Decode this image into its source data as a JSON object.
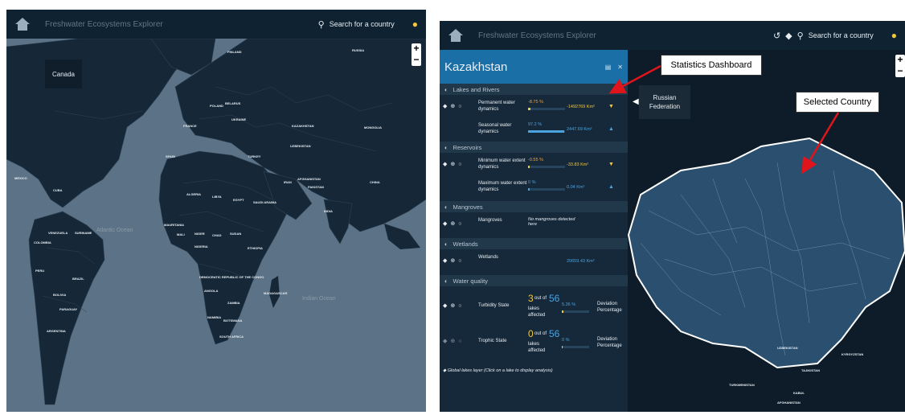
{
  "app": {
    "title": "Freshwater Ecosystems Explorer",
    "search_placeholder": "Search for a country"
  },
  "left_view": {
    "hover_country": "Canada",
    "country_labels": [
      {
        "name": "FINLAND"
      },
      {
        "name": "RUSSIA"
      },
      {
        "name": "POLAND"
      },
      {
        "name": "BELARUS"
      },
      {
        "name": "UKRAINE"
      },
      {
        "name": "KAZAKHSTAN"
      },
      {
        "name": "MONGOLIA"
      },
      {
        "name": "FRANCE"
      },
      {
        "name": "SPAIN"
      },
      {
        "name": "TURKEY"
      },
      {
        "name": "UZBEKISTAN"
      },
      {
        "name": "IRAN"
      },
      {
        "name": "CHINA"
      },
      {
        "name": "AFGHANISTAN"
      },
      {
        "name": "PAKISTAN"
      },
      {
        "name": "ALGERIA"
      },
      {
        "name": "LIBYA"
      },
      {
        "name": "EGYPT"
      },
      {
        "name": "SAUDI ARABIA"
      },
      {
        "name": "INDIA"
      },
      {
        "name": "MAURITANIA"
      },
      {
        "name": "MALI"
      },
      {
        "name": "NIGER"
      },
      {
        "name": "CHAD"
      },
      {
        "name": "SUDAN"
      },
      {
        "name": "NIGERIA"
      },
      {
        "name": "ETHIOPIA"
      },
      {
        "name": "DEMOCRATIC REPUBLIC OF THE CONGO"
      },
      {
        "name": "ANGOLA"
      },
      {
        "name": "ZAMBIA"
      },
      {
        "name": "NAMIBIA"
      },
      {
        "name": "BOTSWANA"
      },
      {
        "name": "SOUTH AFRICA"
      },
      {
        "name": "MADAGASCAR"
      },
      {
        "name": "VENEZUELA"
      },
      {
        "name": "COLOMBIA"
      },
      {
        "name": "PERU"
      },
      {
        "name": "BRAZIL"
      },
      {
        "name": "BOLIVIA"
      },
      {
        "name": "PARAGUAY"
      },
      {
        "name": "ARGENTINA"
      },
      {
        "name": "MEXICO"
      },
      {
        "name": "CUBA"
      },
      {
        "name": "SURINAME"
      }
    ],
    "oceans": [
      {
        "name": "Atlantic Ocean"
      },
      {
        "name": "Indian Ocean"
      }
    ]
  },
  "right_view": {
    "country": "Kazakhstan",
    "neighbor_tooltip": "Russian Federation",
    "map_labels": [
      {
        "name": "TURKMENISTAN"
      },
      {
        "name": "KYRGYZSTAN"
      },
      {
        "name": "UZBEKISTAN"
      },
      {
        "name": "TAJIKISTAN"
      },
      {
        "name": "AFGHANISTAN"
      },
      {
        "name": "KABUL"
      }
    ],
    "sections": [
      {
        "name": "Lakes and Rivers"
      },
      {
        "name": "Reservoirs"
      },
      {
        "name": "Mangroves"
      },
      {
        "name": "Wetlands"
      },
      {
        "name": "Water quality"
      }
    ],
    "rows": {
      "permanent": {
        "name": "Permanent water dynamics",
        "pct": "-8.75 %",
        "value": "-1492769 Km²",
        "fill": 0.06,
        "arrow": "▼"
      },
      "seasonal": {
        "name": "Seasonal water dynamics",
        "pct": "97.2 %",
        "value": "2447.69 Km²",
        "fill": 0.97,
        "arrow": "▲"
      },
      "min_extent": {
        "name": "Minimum water extent dynamics",
        "pct": "-0.55 %",
        "value": "-33.83 Km²",
        "fill": 0.04,
        "arrow": "▼"
      },
      "max_extent": {
        "name": "Maximum water extent dynamics",
        "pct": "0 %",
        "value": "0.04 Km²",
        "fill": 0.0,
        "arrow": "▲"
      },
      "mangroves": {
        "name": "Mangroves",
        "note": "No mangroves detected here"
      },
      "wetlands": {
        "name": "Wetlands",
        "value": "20659.43 Km²"
      },
      "turbidity": {
        "name": "Turbidity State",
        "count": "3",
        "out_of": "out of",
        "total": "56",
        "lakes": "lakes affected",
        "pct": "5.36 %",
        "fill": 0.05,
        "dev": "Deviation Percentage"
      },
      "trophic": {
        "name": "Trophic State",
        "count": "0",
        "out_of": "out of",
        "total": "56",
        "lakes": "lakes affected",
        "pct": "0 %",
        "fill": 0.0,
        "dev": "Deviation Percentage"
      }
    },
    "footer_note": "Global lakes layer (Click on a lake to display analysis)"
  },
  "annotations": {
    "stats": "Statistics Dashboard",
    "selected": "Selected Country"
  },
  "colors": {
    "ocean": "#5c7387",
    "land": "#162838",
    "accent_blue": "#1a6fa6",
    "warning_yellow": "#f3c73e",
    "arrow_red": "#e0141b"
  }
}
